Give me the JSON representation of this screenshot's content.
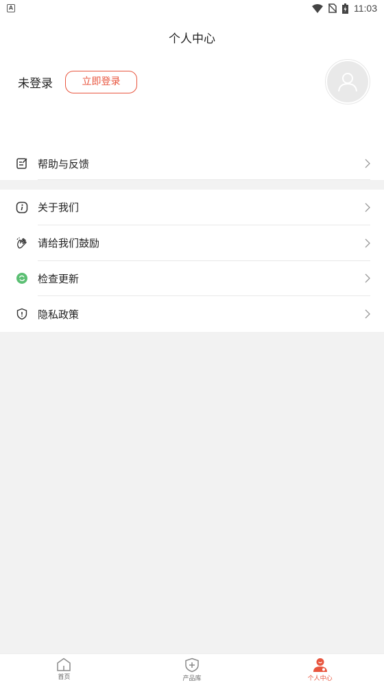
{
  "status_bar": {
    "time": "11:03",
    "left_badge": "A"
  },
  "header": {
    "title": "个人中心",
    "login_status": "未登录",
    "login_button": "立即登录"
  },
  "menu": {
    "help_feedback": "帮助与反馈",
    "about_us": "关于我们",
    "encourage_us": "请给我们鼓励",
    "check_update": "检查更新",
    "privacy_policy": "隐私政策"
  },
  "tabbar": {
    "home": "首页",
    "products": "产品库",
    "profile": "个人中心"
  },
  "colors": {
    "accent": "#e8553e",
    "update_icon_green": "#5bbf73"
  }
}
